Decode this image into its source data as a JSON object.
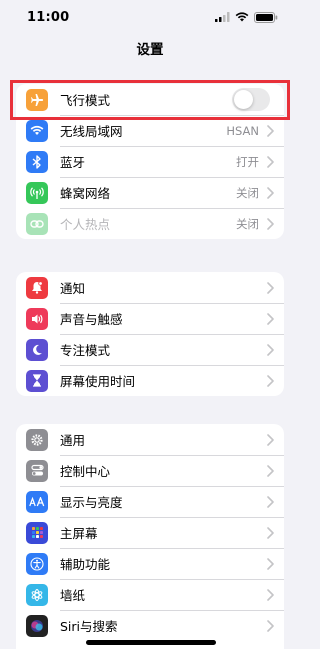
{
  "status_bar": {
    "time": "11:00"
  },
  "nav": {
    "title": "设置"
  },
  "groups": [
    {
      "rows": [
        {
          "label": "飞行模式",
          "icon": "airplane-icon",
          "icon_color": "#f7a13a",
          "toggle_on": false
        },
        {
          "label": "无线局域网",
          "icon": "wifi-icon",
          "icon_color": "#2f7bf6",
          "value": "HSAN"
        },
        {
          "label": "蓝牙",
          "icon": "bluetooth-icon",
          "icon_color": "#2f7bf6",
          "value": "打开"
        },
        {
          "label": "蜂窝网络",
          "icon": "cellular-icon",
          "icon_color": "#35c759",
          "value": "关闭"
        },
        {
          "label": "个人热点",
          "icon": "hotspot-icon",
          "icon_color": "#a8e3b7",
          "value": "关闭",
          "disabled": true
        }
      ]
    },
    {
      "rows": [
        {
          "label": "通知",
          "icon": "notifications-icon",
          "icon_color": "#ee3a40"
        },
        {
          "label": "声音与触感",
          "icon": "sound-icon",
          "icon_color": "#ee3a5a"
        },
        {
          "label": "专注模式",
          "icon": "moon-icon",
          "icon_color": "#5d4fd2"
        },
        {
          "label": "屏幕使用时间",
          "icon": "hourglass-icon",
          "icon_color": "#5d4fd2"
        }
      ]
    },
    {
      "rows": [
        {
          "label": "通用",
          "icon": "gear-icon",
          "icon_color": "#8e8e93"
        },
        {
          "label": "控制中心",
          "icon": "toggles-icon",
          "icon_color": "#8e8e93"
        },
        {
          "label": "显示与亮度",
          "icon": "text-size-icon",
          "icon_color": "#2f7bf6"
        },
        {
          "label": "主屏幕",
          "icon": "home-grid-icon",
          "icon_color": "#3a4ad8"
        },
        {
          "label": "辅助功能",
          "icon": "accessibility-icon",
          "icon_color": "#2f7bf6"
        },
        {
          "label": "墙纸",
          "icon": "wallpaper-icon",
          "icon_color": "#35b7e8"
        },
        {
          "label": "Siri与搜索",
          "icon": "siri-icon",
          "icon_color": "#222222"
        }
      ]
    }
  ],
  "colors": {
    "highlight": "#e8303a",
    "background": "#f2f2f7"
  }
}
